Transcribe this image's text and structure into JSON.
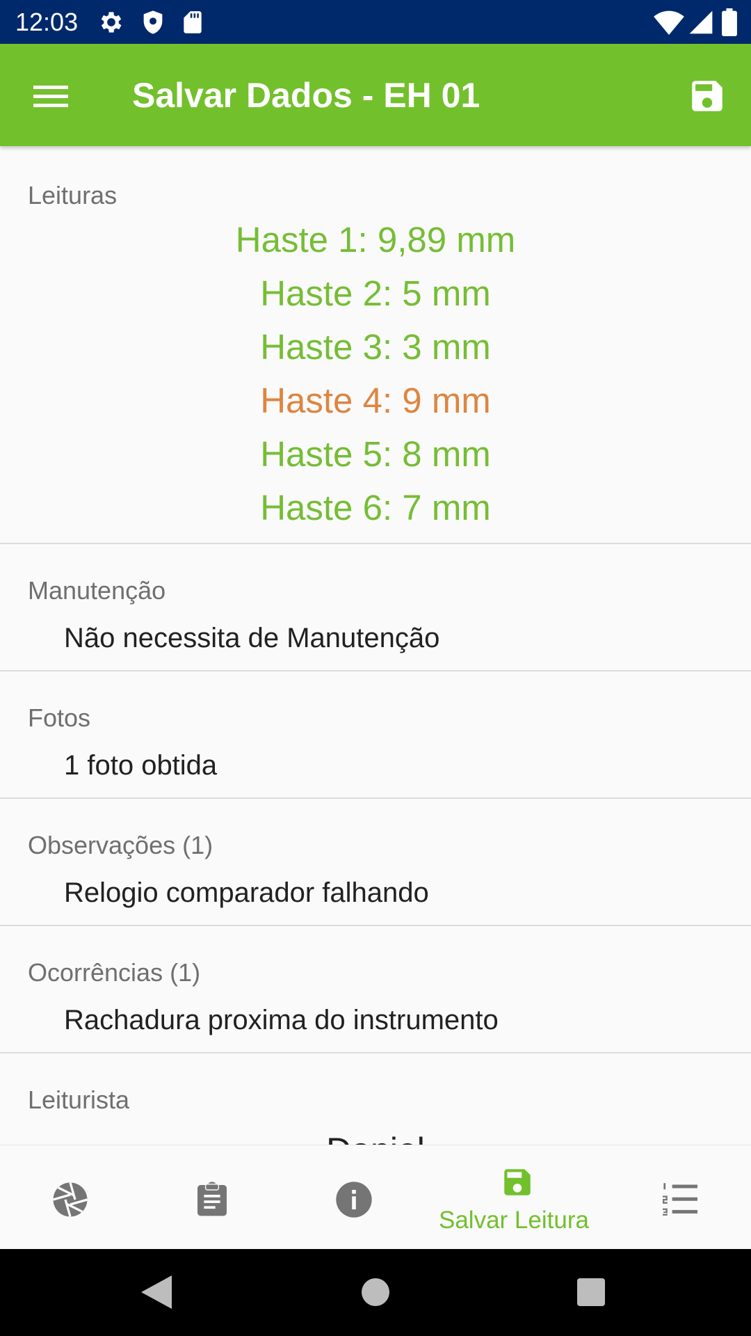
{
  "status_bar": {
    "time": "12:03",
    "icons": [
      "settings-icon",
      "shield-icon",
      "sd-card-icon",
      "wifi-icon",
      "signal-icon",
      "battery-icon"
    ]
  },
  "app_bar": {
    "title": "Salvar Dados - EH 01",
    "left_icon": "menu-icon",
    "right_icon": "save-icon"
  },
  "colors": {
    "app_bar": "#72c02c",
    "status_bar": "#00296b",
    "reading_ok": "#76bd35",
    "reading_warn": "#de8540"
  },
  "sections": {
    "leituras": {
      "label": "Leituras",
      "readings": [
        {
          "text": "Haste 1: 9,89 mm",
          "status": "ok"
        },
        {
          "text": "Haste 2: 5 mm",
          "status": "ok"
        },
        {
          "text": "Haste 3: 3 mm",
          "status": "ok"
        },
        {
          "text": "Haste 4: 9 mm",
          "status": "warn"
        },
        {
          "text": "Haste 5: 8 mm",
          "status": "ok"
        },
        {
          "text": "Haste 6: 7 mm",
          "status": "ok"
        }
      ]
    },
    "manutencao": {
      "label": "Manutenção",
      "value": "Não necessita de Manutenção"
    },
    "fotos": {
      "label": "Fotos",
      "value": "1 foto obtida"
    },
    "observacoes": {
      "label": "Observações (1)",
      "value": "Relogio comparador falhando"
    },
    "ocorrencias": {
      "label": "Ocorrências (1)",
      "value": "Rachadura proxima do instrumento"
    },
    "leiturista": {
      "label": "Leiturista",
      "value": "Daniel"
    }
  },
  "bottom_nav": {
    "items": [
      {
        "icon": "camera-shutter-icon",
        "label": "",
        "active": false
      },
      {
        "icon": "clipboard-icon",
        "label": "",
        "active": false
      },
      {
        "icon": "info-icon",
        "label": "",
        "active": false
      },
      {
        "icon": "save-icon",
        "label": "Salvar Leitura",
        "active": true
      },
      {
        "icon": "numbered-list-icon",
        "label": "",
        "active": false
      }
    ]
  },
  "system_nav": [
    "back-icon",
    "home-icon",
    "recents-icon"
  ]
}
